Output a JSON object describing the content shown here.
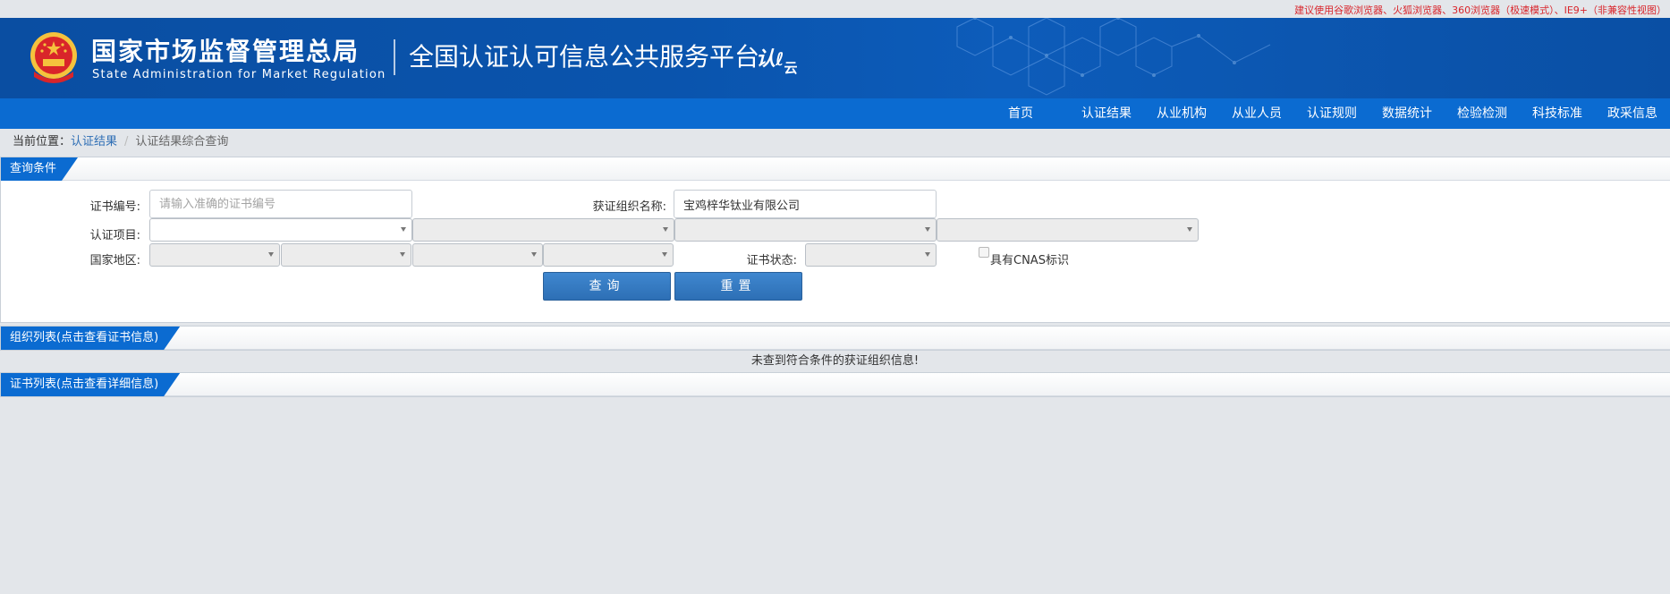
{
  "topbar": {
    "browser_notice": "建议使用谷歌浏览器、火狐浏览器、360浏览器（极速模式）、IE9+（非兼容性视图）"
  },
  "header": {
    "agency_cn": "国家市场监督管理总局",
    "agency_en": "State Administration  for  Market Regulation",
    "platform_title": "全国认证认可信息公共服务平台",
    "cloud_logo_main": "认",
    "cloud_logo_sub": "云",
    "emblem_icon": "national-emblem-icon"
  },
  "nav": {
    "items": [
      {
        "label": "首页"
      },
      {
        "label": "认证结果"
      },
      {
        "label": "从业机构"
      },
      {
        "label": "从业人员"
      },
      {
        "label": "认证规则"
      },
      {
        "label": "数据统计"
      },
      {
        "label": "检验检测"
      },
      {
        "label": "科技标准"
      },
      {
        "label": "政采信息"
      }
    ]
  },
  "breadcrumb": {
    "prefix": "当前位置：",
    "link": "认证结果",
    "separator": "/",
    "current": "认证结果综合查询"
  },
  "query": {
    "section_title": "查询条件",
    "cert_no_label": "证书编号:",
    "cert_no_placeholder": "请输入准确的证书编号",
    "cert_no_value": "",
    "org_name_label": "获证组织名称:",
    "org_name_value": "宝鸡梓华钛业有限公司",
    "project_label": "认证项目:",
    "region_label": "国家地区:",
    "status_label": "证书状态:",
    "cnas_label": "具有CNAS标识",
    "search_button": "查询",
    "reset_button": "重置"
  },
  "org_list": {
    "section_title": "组织列表(点击查看证书信息)",
    "empty_message": "未查到符合条件的获证组织信息!"
  },
  "cert_list": {
    "section_title": "证书列表(点击查看详细信息)"
  },
  "colors": {
    "header_blue": "#0a4ea2",
    "nav_blue": "#0b6bd1",
    "button_blue": "#2d6fb5",
    "notice_red": "#d9262c",
    "page_bg": "#e3e6ea"
  }
}
